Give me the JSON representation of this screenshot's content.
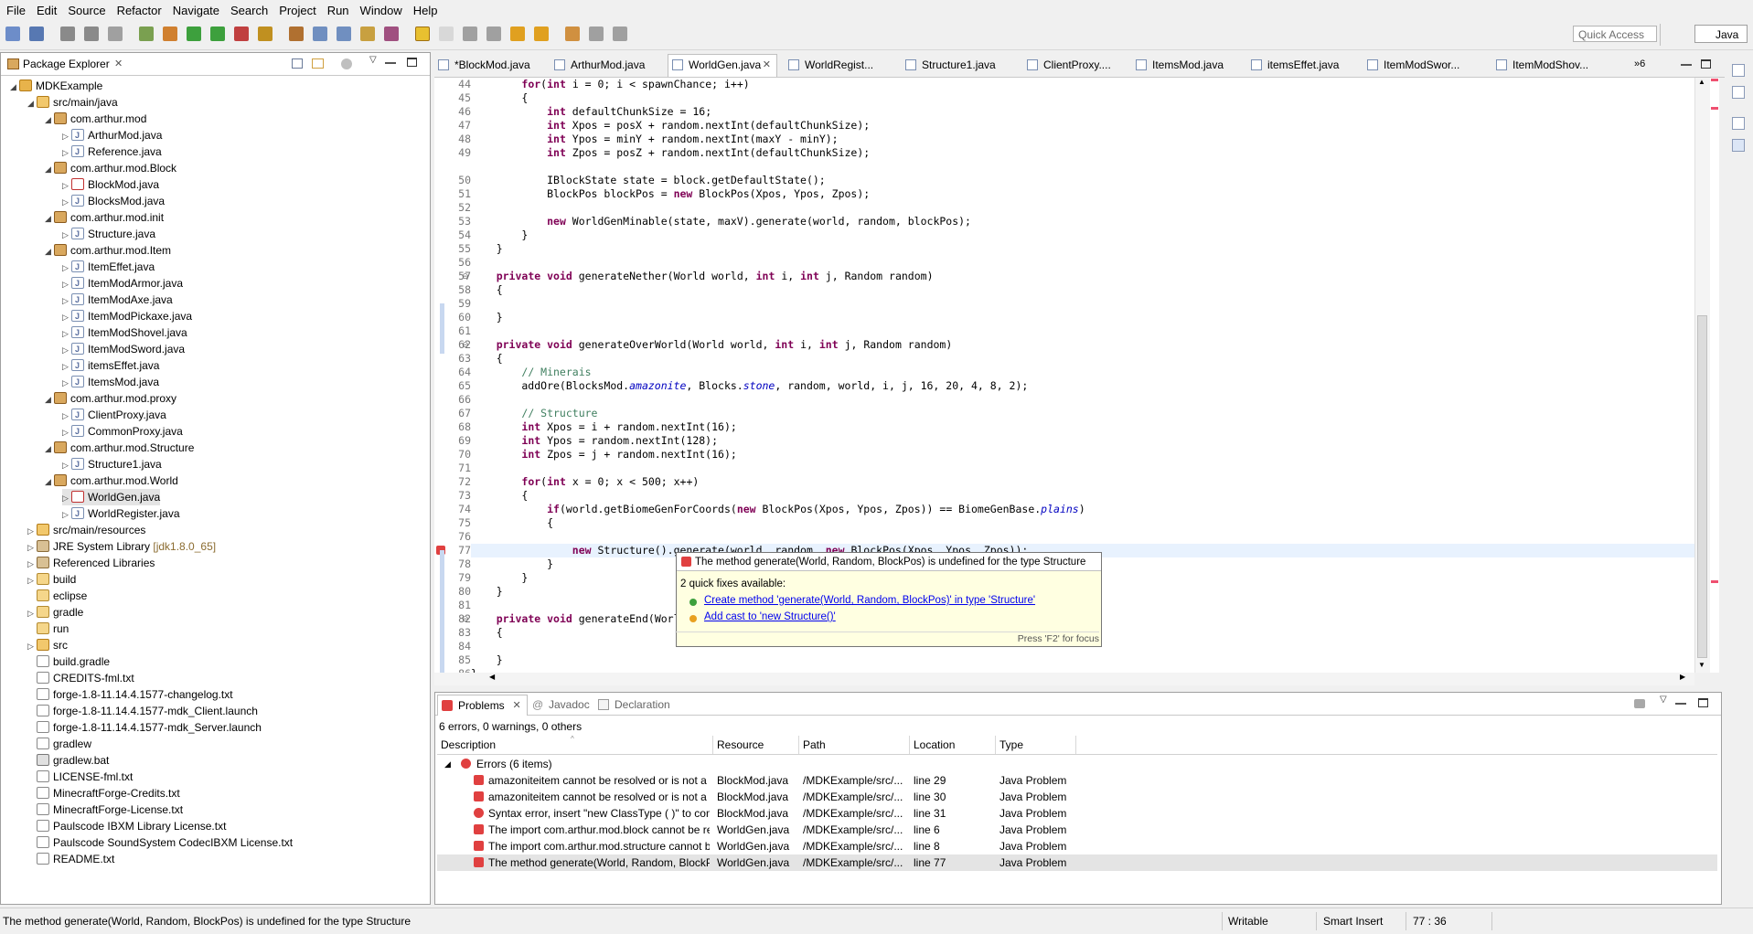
{
  "menu": [
    "File",
    "Edit",
    "Source",
    "Refactor",
    "Navigate",
    "Search",
    "Project",
    "Run",
    "Window",
    "Help"
  ],
  "quick_access": "Quick Access",
  "perspective": "Java",
  "package_explorer": {
    "title": "Package Explorer",
    "tree": [
      {
        "label": "MDKExample",
        "indent": 0,
        "arrow": "◢",
        "icon": "i-project"
      },
      {
        "label": "src/main/java",
        "indent": 1,
        "arrow": "◢",
        "icon": "i-srcfolder"
      },
      {
        "label": "com.arthur.mod",
        "indent": 2,
        "arrow": "◢",
        "icon": "i-pkg"
      },
      {
        "label": "ArthurMod.java",
        "indent": 3,
        "arrow": "▷",
        "icon": "i-java"
      },
      {
        "label": "Reference.java",
        "indent": 3,
        "arrow": "▷",
        "icon": "i-java"
      },
      {
        "label": "com.arthur.mod.Block",
        "indent": 2,
        "arrow": "◢",
        "icon": "i-pkg"
      },
      {
        "label": "BlockMod.java",
        "indent": 3,
        "arrow": "▷",
        "icon": "i-java-err"
      },
      {
        "label": "BlocksMod.java",
        "indent": 3,
        "arrow": "▷",
        "icon": "i-java"
      },
      {
        "label": "com.arthur.mod.init",
        "indent": 2,
        "arrow": "◢",
        "icon": "i-pkg"
      },
      {
        "label": "Structure.java",
        "indent": 3,
        "arrow": "▷",
        "icon": "i-java"
      },
      {
        "label": "com.arthur.mod.Item",
        "indent": 2,
        "arrow": "◢",
        "icon": "i-pkg"
      },
      {
        "label": "ItemEffet.java",
        "indent": 3,
        "arrow": "▷",
        "icon": "i-java"
      },
      {
        "label": "ItemModArmor.java",
        "indent": 3,
        "arrow": "▷",
        "icon": "i-java"
      },
      {
        "label": "ItemModAxe.java",
        "indent": 3,
        "arrow": "▷",
        "icon": "i-java"
      },
      {
        "label": "ItemModPickaxe.java",
        "indent": 3,
        "arrow": "▷",
        "icon": "i-java"
      },
      {
        "label": "ItemModShovel.java",
        "indent": 3,
        "arrow": "▷",
        "icon": "i-java"
      },
      {
        "label": "ItemModSword.java",
        "indent": 3,
        "arrow": "▷",
        "icon": "i-java"
      },
      {
        "label": "itemsEffet.java",
        "indent": 3,
        "arrow": "▷",
        "icon": "i-java"
      },
      {
        "label": "ItemsMod.java",
        "indent": 3,
        "arrow": "▷",
        "icon": "i-java"
      },
      {
        "label": "com.arthur.mod.proxy",
        "indent": 2,
        "arrow": "◢",
        "icon": "i-pkg"
      },
      {
        "label": "ClientProxy.java",
        "indent": 3,
        "arrow": "▷",
        "icon": "i-java"
      },
      {
        "label": "CommonProxy.java",
        "indent": 3,
        "arrow": "▷",
        "icon": "i-java"
      },
      {
        "label": "com.arthur.mod.Structure",
        "indent": 2,
        "arrow": "◢",
        "icon": "i-pkg"
      },
      {
        "label": "Structure1.java",
        "indent": 3,
        "arrow": "▷",
        "icon": "i-java"
      },
      {
        "label": "com.arthur.mod.World",
        "indent": 2,
        "arrow": "◢",
        "icon": "i-pkg"
      },
      {
        "label": "WorldGen.java",
        "indent": 3,
        "arrow": "▷",
        "icon": "i-java-err"
      },
      {
        "label": "WorldRegister.java",
        "indent": 3,
        "arrow": "▷",
        "icon": "i-java"
      },
      {
        "label": "src/main/resources",
        "indent": 1,
        "arrow": "▷",
        "icon": "i-srcfolder"
      },
      {
        "label": "JRE System Library",
        "suffix": "[jdk1.8.0_65]",
        "indent": 1,
        "arrow": "▷",
        "icon": "i-lib"
      },
      {
        "label": "Referenced Libraries",
        "indent": 1,
        "arrow": "▷",
        "icon": "i-lib"
      },
      {
        "label": "build",
        "indent": 1,
        "arrow": "▷",
        "icon": "i-folder"
      },
      {
        "label": "eclipse",
        "indent": 1,
        "arrow": "",
        "icon": "i-folder"
      },
      {
        "label": "gradle",
        "indent": 1,
        "arrow": "▷",
        "icon": "i-folder"
      },
      {
        "label": "run",
        "indent": 1,
        "arrow": "",
        "icon": "i-folder"
      },
      {
        "label": "src",
        "indent": 1,
        "arrow": "▷",
        "icon": "i-srcfolder"
      },
      {
        "label": "build.gradle",
        "indent": 1,
        "arrow": "",
        "icon": "i-file"
      },
      {
        "label": "CREDITS-fml.txt",
        "indent": 1,
        "arrow": "",
        "icon": "i-file"
      },
      {
        "label": "forge-1.8-11.14.4.1577-changelog.txt",
        "indent": 1,
        "arrow": "",
        "icon": "i-file"
      },
      {
        "label": "forge-1.8-11.14.4.1577-mdk_Client.launch",
        "indent": 1,
        "arrow": "",
        "icon": "i-file"
      },
      {
        "label": "forge-1.8-11.14.4.1577-mdk_Server.launch",
        "indent": 1,
        "arrow": "",
        "icon": "i-file"
      },
      {
        "label": "gradlew",
        "indent": 1,
        "arrow": "",
        "icon": "i-file"
      },
      {
        "label": "gradlew.bat",
        "indent": 1,
        "arrow": "",
        "icon": "i-bat"
      },
      {
        "label": "LICENSE-fml.txt",
        "indent": 1,
        "arrow": "",
        "icon": "i-file"
      },
      {
        "label": "MinecraftForge-Credits.txt",
        "indent": 1,
        "arrow": "",
        "icon": "i-file"
      },
      {
        "label": "MinecraftForge-License.txt",
        "indent": 1,
        "arrow": "",
        "icon": "i-file"
      },
      {
        "label": "Paulscode IBXM Library License.txt",
        "indent": 1,
        "arrow": "",
        "icon": "i-file"
      },
      {
        "label": "Paulscode SoundSystem CodecIBXM License.txt",
        "indent": 1,
        "arrow": "",
        "icon": "i-file"
      },
      {
        "label": "README.txt",
        "indent": 1,
        "arrow": "",
        "icon": "i-file"
      }
    ]
  },
  "editor_tabs": [
    {
      "label": "*BlockMod.java",
      "active": false
    },
    {
      "label": "ArthurMod.java",
      "active": false
    },
    {
      "label": "WorldGen.java",
      "active": true
    },
    {
      "label": "WorldRegist...",
      "active": false
    },
    {
      "label": "Structure1.java",
      "active": false
    },
    {
      "label": "ClientProxy....",
      "active": false
    },
    {
      "label": "ItemsMod.java",
      "active": false
    },
    {
      "label": "itemsEffet.java",
      "active": false
    },
    {
      "label": "ItemModSwor...",
      "active": false
    },
    {
      "label": "ItemModShov...",
      "active": false
    }
  ],
  "editor_tabs_overflow": "»6",
  "code": {
    "current_line": "77",
    "lines": [
      {
        "n": "44",
        "html": "        <span class='kw'>for</span>(<span class='kw'>int</span> i = 0; i &lt; spawnChance; i++)"
      },
      {
        "n": "45",
        "html": "        {"
      },
      {
        "n": "46",
        "html": "            <span class='kw'>int</span> defaultChunkSize = 16;"
      },
      {
        "n": "47",
        "html": "            <span class='kw'>int</span> Xpos = posX + random.nextInt(defaultChunkSize);"
      },
      {
        "n": "48",
        "html": "            <span class='kw'>int</span> Ypos = minY + random.nextInt(maxY - minY);"
      },
      {
        "n": "49",
        "html": "            <span class='kw'>int</span> Zpos = posZ + random.nextInt(defaultChunkSize);"
      },
      {
        "n": "49b",
        "html": ""
      },
      {
        "n": "50",
        "html": "            IBlockState state = block.getDefaultState();"
      },
      {
        "n": "51",
        "html": "            BlockPos blockPos = <span class='kw'>new</span> BlockPos(Xpos, Ypos, Zpos);"
      },
      {
        "n": "52",
        "html": ""
      },
      {
        "n": "53",
        "html": "            <span class='kw'>new</span> WorldGenMinable(state, maxV).generate(world, random, blockPos);"
      },
      {
        "n": "54",
        "html": "        }"
      },
      {
        "n": "55",
        "html": "    }"
      },
      {
        "n": "56",
        "html": ""
      },
      {
        "n": "57",
        "html": "    <span class='kw'>private</span> <span class='kw'>void</span> generateNether(World world, <span class='kw'>int</span> i, <span class='kw'>int</span> j, Random random)",
        "fold": true
      },
      {
        "n": "58",
        "html": "    {"
      },
      {
        "n": "59",
        "html": ""
      },
      {
        "n": "60",
        "html": "    }"
      },
      {
        "n": "61",
        "html": ""
      },
      {
        "n": "62",
        "html": "    <span class='kw'>private</span> <span class='kw'>void</span> generateOverWorld(World world, <span class='kw'>int</span> i, <span class='kw'>int</span> j, Random random)",
        "fold": true
      },
      {
        "n": "63",
        "html": "    {"
      },
      {
        "n": "64",
        "html": "        <span class='cm'>// Minerais</span>"
      },
      {
        "n": "65",
        "html": "        addOre(BlocksMod.<span class='fld'>amazonite</span>, Blocks.<span class='fld'>stone</span>, random, world, i, j, 16, 20, 4, 8, 2);"
      },
      {
        "n": "66",
        "html": ""
      },
      {
        "n": "67",
        "html": "        <span class='cm'>// Structure</span>"
      },
      {
        "n": "68",
        "html": "        <span class='kw'>int</span> Xpos = i + random.nextInt(16);"
      },
      {
        "n": "69",
        "html": "        <span class='kw'>int</span> Ypos = random.nextInt(128);"
      },
      {
        "n": "70",
        "html": "        <span class='kw'>int</span> Zpos = j + random.nextInt(16);"
      },
      {
        "n": "71",
        "html": ""
      },
      {
        "n": "72",
        "html": "        <span class='kw'>for</span>(<span class='kw'>int</span> x = 0; x &lt; 500; x++)"
      },
      {
        "n": "73",
        "html": "        {"
      },
      {
        "n": "74",
        "html": "            <span class='kw'>if</span>(world.getBiomeGenForCoords(<span class='kw'>new</span> BlockPos(Xpos, Ypos, Zpos)) == BiomeGenBase.<span class='fld'>plains</span>)"
      },
      {
        "n": "75",
        "html": "            {"
      },
      {
        "n": "76",
        "html": ""
      },
      {
        "n": "77",
        "html": "                <span class='kw'>new</span> Structure().generate(world, random, <span class='kw'>new</span> BlockPos(Xpos, Ypos, Zpos));",
        "err": true
      },
      {
        "n": "78",
        "html": "            }"
      },
      {
        "n": "79",
        "html": "        }"
      },
      {
        "n": "80",
        "html": "    }"
      },
      {
        "n": "81",
        "html": ""
      },
      {
        "n": "82",
        "html": "    <span class='kw'>private</span> <span class='kw'>void</span> generateEnd(World world, <span class='kw'>int</span> i, <span class='kw'>int</span> j, Random random)",
        "fold": true
      },
      {
        "n": "83",
        "html": "    {"
      },
      {
        "n": "84",
        "html": ""
      },
      {
        "n": "85",
        "html": "    }"
      },
      {
        "n": "86",
        "html": "}"
      }
    ]
  },
  "hover": {
    "title": "The method generate(World, Random, BlockPos) is undefined for the type Structure",
    "count": "2 quick fixes available:",
    "fixes": [
      "Create method 'generate(World, Random, BlockPos)' in type 'Structure'",
      "Add cast to 'new Structure()'"
    ],
    "hint": "Press 'F2' for focus"
  },
  "problems": {
    "tabs": [
      "Problems",
      "Javadoc",
      "Declaration"
    ],
    "summary": "6 errors, 0 warnings, 0 others",
    "columns": [
      "Description",
      "Resource",
      "Path",
      "Location",
      "Type"
    ],
    "group": "Errors (6 items)",
    "rows": [
      {
        "desc": "amazoniteitem cannot be resolved or is not a field",
        "res": "BlockMod.java",
        "path": "/MDKExample/src/...",
        "loc": "line 29",
        "type": "Java Problem"
      },
      {
        "desc": "amazoniteitem cannot be resolved or is not a field",
        "res": "BlockMod.java",
        "path": "/MDKExample/src/...",
        "loc": "line 30",
        "type": "Java Problem"
      },
      {
        "desc": "Syntax error, insert \"new ClassType ( )\" to complete Expression",
        "res": "BlockMod.java",
        "path": "/MDKExample/src/...",
        "loc": "line 31",
        "type": "Java Problem"
      },
      {
        "desc": "The import com.arthur.mod.block cannot be resolved",
        "res": "WorldGen.java",
        "path": "/MDKExample/src/...",
        "loc": "line 6",
        "type": "Java Problem"
      },
      {
        "desc": "The import com.arthur.mod.structure cannot be resolved",
        "res": "WorldGen.java",
        "path": "/MDKExample/src/...",
        "loc": "line 8",
        "type": "Java Problem"
      },
      {
        "desc": "The method generate(World, Random, BlockPos) is undefined",
        "res": "WorldGen.java",
        "path": "/MDKExample/src/...",
        "loc": "line 77",
        "type": "Java Problem"
      }
    ]
  },
  "status": {
    "message": "The method generate(World, Random, BlockPos) is undefined for the type Structure",
    "writable": "Writable",
    "insert_mode": "Smart Insert",
    "position": "77 : 36"
  }
}
